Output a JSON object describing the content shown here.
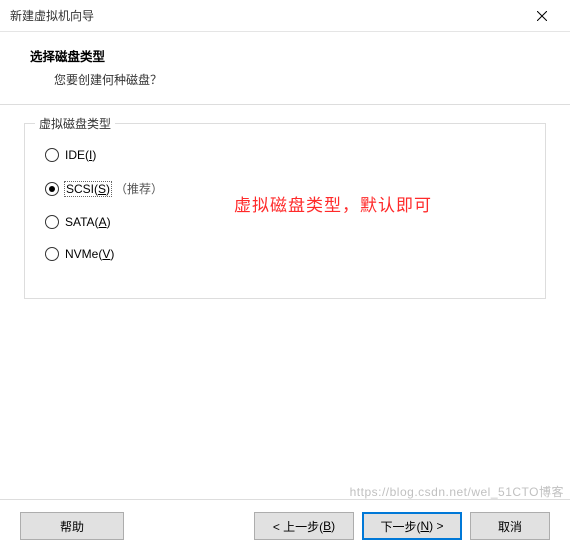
{
  "window": {
    "title": "新建虚拟机向导"
  },
  "header": {
    "title": "选择磁盘类型",
    "subtitle": "您要创建何种磁盘？"
  },
  "group": {
    "legend": "虚拟磁盘类型"
  },
  "options": {
    "ide": {
      "prefix": "IDE(",
      "key": "I",
      "suffix": ")"
    },
    "scsi": {
      "prefix": "SCSI(",
      "key": "S",
      "suffix": ")",
      "recommend": "（推荐）"
    },
    "sata": {
      "prefix": "SATA(",
      "key": "A",
      "suffix": ")"
    },
    "nvme": {
      "prefix": "NVMe(",
      "key": "V",
      "suffix": ")"
    }
  },
  "annotation": "虚拟磁盘类型，默认即可",
  "buttons": {
    "help": "帮助",
    "back_pre": "< 上一步(",
    "back_key": "B",
    "back_suf": ")",
    "next_pre": "下一步(",
    "next_key": "N",
    "next_suf": ") >",
    "cancel": "取消"
  },
  "watermark": "https://blog.csdn.net/wel_51CTO博客"
}
